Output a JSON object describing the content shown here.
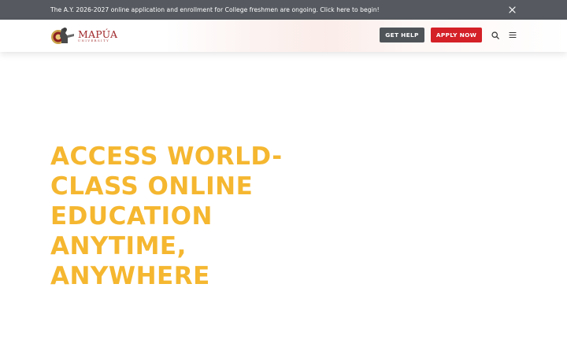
{
  "announcement": {
    "text": "The A.Y. 2026-2027 online application and enrollment for College freshmen are ongoing. Click here to begin!",
    "close_icon": "close-icon"
  },
  "header": {
    "logo": {
      "name": "MAPÚA",
      "subtitle": "UNIVERSITY"
    },
    "buttons": {
      "get_help": "GET HELP",
      "apply_now": "APPLY NOW"
    },
    "icons": [
      "search-icon",
      "menu-icon"
    ]
  },
  "hero": {
    "title": "ACCESS WORLD-CLASS ONLINE EDUCATION ANYTIME, ANYWHERE"
  },
  "colors": {
    "announcement_bg": "#565a60",
    "get_help_bg": "#4f5459",
    "apply_now_bg": "#d42027",
    "hero_title": "#f5b730",
    "logo_red": "#a0282b"
  }
}
